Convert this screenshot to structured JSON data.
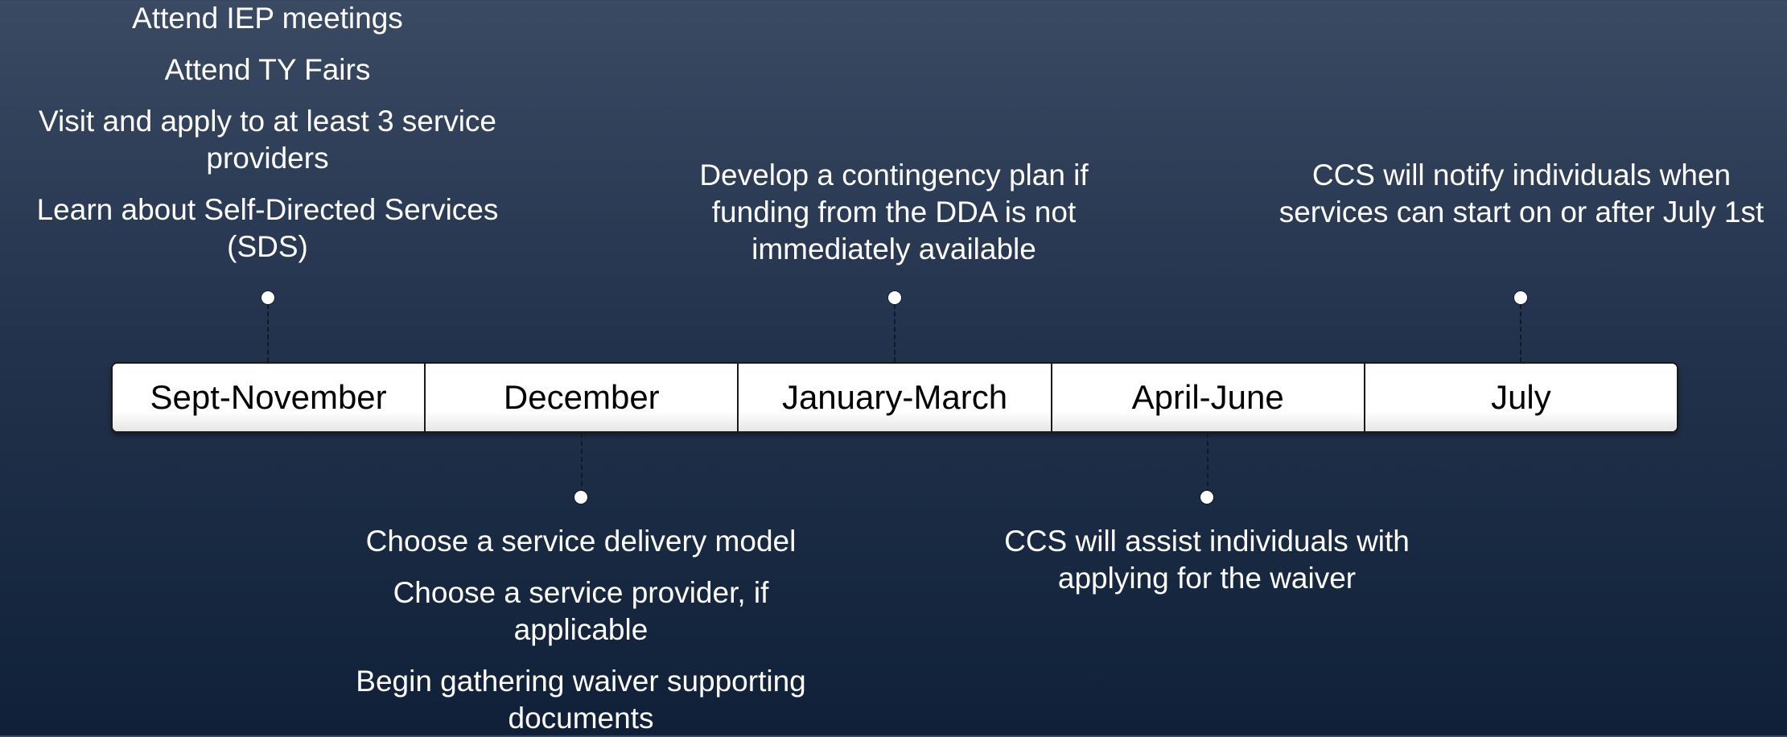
{
  "timeline": {
    "periods": [
      "Sept-November",
      "December",
      "January-March",
      "April-June",
      "July"
    ]
  },
  "notes": {
    "sept_november": [
      "Attend IEP meetings",
      "Attend TY Fairs",
      "Visit and apply to at least 3 service providers",
      "Learn about Self-Directed Services (SDS)"
    ],
    "december": [
      "Choose a service delivery model",
      "Choose a service provider, if applicable",
      "Begin gathering waiver supporting documents"
    ],
    "january_march": [
      "Develop a contingency plan if funding from the DDA is not immediately available"
    ],
    "april_june": [
      "CCS will assist individuals with applying for the waiver"
    ],
    "july": [
      "CCS will notify individuals when services can start on or after July 1st"
    ]
  },
  "colors": {
    "background_top": "#3b4a63",
    "background_bottom": "#0f2038",
    "bar_fill": "#ffffff",
    "text": "#ffffff"
  }
}
